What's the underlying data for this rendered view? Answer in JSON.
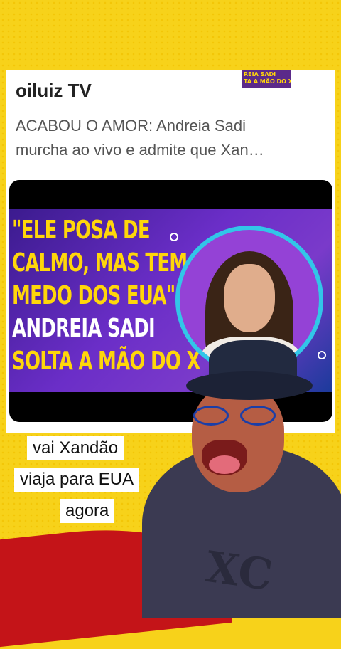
{
  "card": {
    "channel": "oiluiz TV",
    "mini_thumb_lines": [
      "REIA SADI",
      "TA A MÃO DO XANDÃ"
    ],
    "title_line1": "ACABOU O AMOR: Andreia Sadi",
    "title_line2": "murcha ao vivo e admite que Xan…"
  },
  "thumbnail": {
    "headline_lines": [
      "\"ELE POSA DE",
      "CALMO, MAS TEM",
      "MEDO DOS EUA\"",
      "ANDREIA SADI",
      "SOLTA A MÃO DO X"
    ]
  },
  "overlay": {
    "caption_line1": "vai Xandão",
    "caption_line2": "viaja para  EUA",
    "caption_line3": "agora",
    "hoodie_text": "XC"
  },
  "colors": {
    "background": "#f7d21a",
    "accent_red": "#c41418",
    "headline_yellow": "#ffd60a",
    "thumb_purple": "#6b2ec8",
    "ring_cyan": "#32c6e8"
  }
}
